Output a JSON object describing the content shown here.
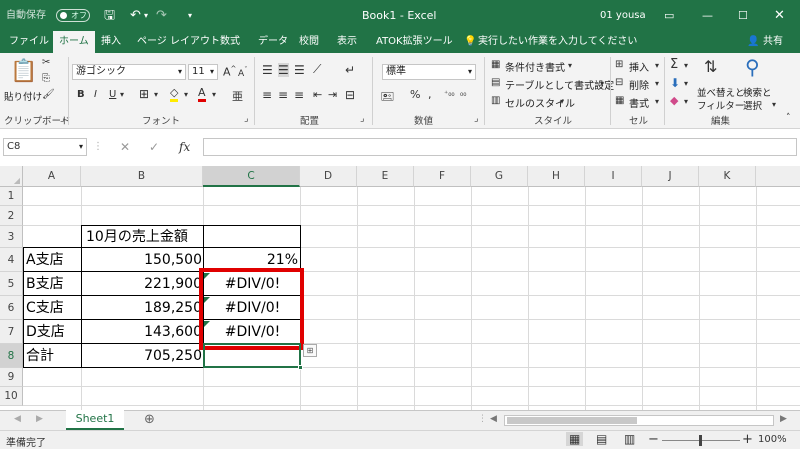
{
  "titlebar": {
    "autosave_label": "自動保存",
    "autosave_state": "オフ",
    "document_title": "Book1  -  Excel",
    "user": "01 yousa"
  },
  "tabs": [
    "ファイル",
    "ホーム",
    "挿入",
    "ページ レイアウト",
    "数式",
    "データ",
    "校閲",
    "表示",
    "ATOK拡張ツール"
  ],
  "tell_me": "実行したい作業を入力してください",
  "share": "共有",
  "ribbon": {
    "paste_label": "貼り付け",
    "clipboard_label": "クリップボード",
    "font_name": "游ゴシック",
    "font_size": "11",
    "font_group_label": "フォント",
    "align_group_label": "配置",
    "number_format": "標準",
    "number_group_label": "数値",
    "conditional_format": "条件付き書式",
    "format_as_table": "テーブルとして書式設定",
    "cell_styles": "セルのスタイル",
    "style_group_label": "スタイル",
    "insert": "挿入",
    "delete": "削除",
    "format": "書式",
    "cells_group_label": "セル",
    "sort_filter_1": "並べ替えと",
    "sort_filter_2": "フィルター",
    "find_select_1": "検索と",
    "find_select_2": "選択",
    "editing_group_label": "編集"
  },
  "formula_bar": {
    "name_box": "C8",
    "fx": "fx",
    "formula": ""
  },
  "columns": [
    "A",
    "B",
    "C",
    "D",
    "E",
    "F",
    "G",
    "H",
    "I",
    "J",
    "K"
  ],
  "rows": [
    "1",
    "2",
    "3",
    "4",
    "5",
    "6",
    "7",
    "8",
    "9",
    "10"
  ],
  "cells": {
    "B3": "10月の売上金額",
    "A4": "A支店",
    "B4": "150,500",
    "C4": "21%",
    "A5": "B支店",
    "B5": "221,900",
    "C5": "#DIV/0!",
    "A6": "C支店",
    "B6": "189,250",
    "C6": "#DIV/0!",
    "A7": "D支店",
    "B7": "143,600",
    "C7": "#DIV/0!",
    "A8": "合計",
    "B8": "705,250"
  },
  "sheet_tab": "Sheet1",
  "status": {
    "ready": "準備完了",
    "zoom": "100%"
  },
  "colors": {
    "excel_green": "#217346",
    "highlight": "#e00000"
  }
}
